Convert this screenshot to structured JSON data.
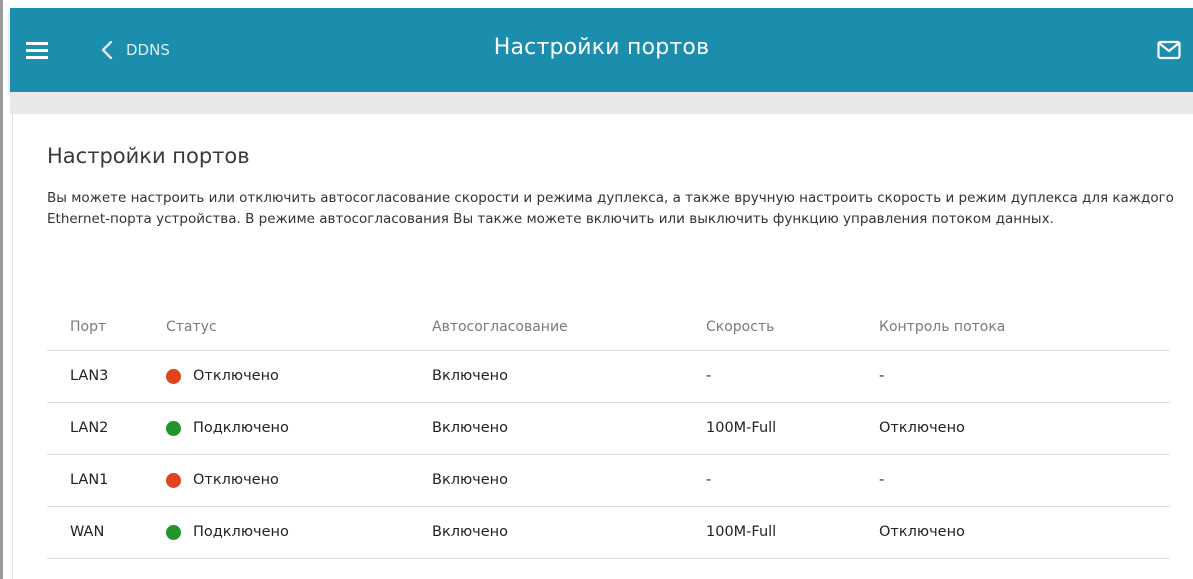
{
  "header": {
    "back_label": "DDNS",
    "title": "Настройки портов",
    "menu_icon": "hamburger-icon",
    "back_icon": "chevron-left-icon",
    "mail_icon": "mail-icon",
    "color": "#1b8eae"
  },
  "main": {
    "title": "Настройки портов",
    "description": "Вы можете настроить или отключить автосогласование скорости и режима дуплекса, а также вручную настроить скорость и режим дуплекса для каждого Ethernet-порта устройства. В режиме автосогласования Вы также можете включить или выключить функцию управления потоком данных."
  },
  "table": {
    "headers": [
      "Порт",
      "Статус",
      "Автосогласование",
      "Скорость",
      "Контроль потока"
    ],
    "rows": [
      {
        "port": "LAN3",
        "status": "Отключено",
        "status_color": "#e2431d",
        "auto": "Включено",
        "speed": "-",
        "flow": "-"
      },
      {
        "port": "LAN2",
        "status": "Подключено",
        "status_color": "#20952c",
        "auto": "Включено",
        "speed": "100M-Full",
        "flow": "Отключено"
      },
      {
        "port": "LAN1",
        "status": "Отключено",
        "status_color": "#e2431d",
        "auto": "Включено",
        "speed": "-",
        "flow": "-"
      },
      {
        "port": "WAN",
        "status": "Подключено",
        "status_color": "#20952c",
        "auto": "Включено",
        "speed": "100M-Full",
        "flow": "Отключено"
      }
    ]
  }
}
